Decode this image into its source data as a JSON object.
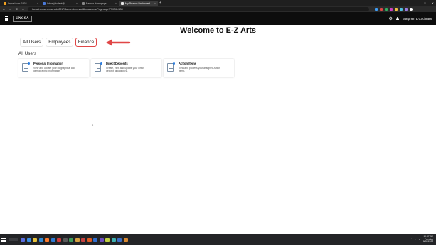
{
  "browser": {
    "tabs": [
      {
        "label": "Import from ExEd",
        "fav_color": "#f0a020",
        "active": false
      },
      {
        "label": "Inbox (student@)",
        "fav_color": "#4a79d8",
        "active": false
      },
      {
        "label": "Banner Homepage",
        "fav_color": "#888888",
        "active": false
      },
      {
        "label": "My Finance Dashboard",
        "fav_color": "#e8e8e8",
        "active": true
      }
    ],
    "new_tab": "+",
    "window_controls": [
      "–",
      "□",
      "✕"
    ],
    "url": "banw1.uncsa.uncsa.edu:8017/BannerAdminAdditions/ssomePage.aspx?FROM=SB8",
    "ext_colors": [
      "#3f9ef5",
      "#e04646",
      "#30b060",
      "#d040c0",
      "#f0c040",
      "#50c0e0",
      "#9a7be0",
      "#ffffff"
    ]
  },
  "header": {
    "logo": "UNCSA",
    "user_name": "Stephen L Cochrane"
  },
  "main": {
    "title": "Welcome to E-Z Arts",
    "tabs": [
      "All Users",
      "Employees",
      "Finance"
    ],
    "highlighted_tab": "Finance",
    "section_title": "All Users",
    "cards": [
      {
        "title": "Personal Information",
        "desc": "View and update your biographical and demographic information."
      },
      {
        "title": "Direct Deposits",
        "desc": "Create, view and update your direct deposit allocation(s)."
      },
      {
        "title": "Action Items",
        "desc": "View and process your assigned Action Items."
      }
    ],
    "arrow_color": "#e04646"
  },
  "taskbar": {
    "icon_colors": [
      "#5b6ee0",
      "#3a8ee6",
      "#e8c23a",
      "#2f8ad8",
      "#ff7a2a",
      "#2e7ad4",
      "#d23a3a",
      "#5a5a5a",
      "#3c9a5a",
      "#d6a040",
      "#c64040",
      "#e05a20",
      "#2f6ed0",
      "#6c4cc0",
      "#c0d040",
      "#3cb0b0",
      "#3a6ec8",
      "#d88830"
    ],
    "time": "10:47 AM",
    "day": "Tuesday",
    "date": "8/22/2023"
  }
}
